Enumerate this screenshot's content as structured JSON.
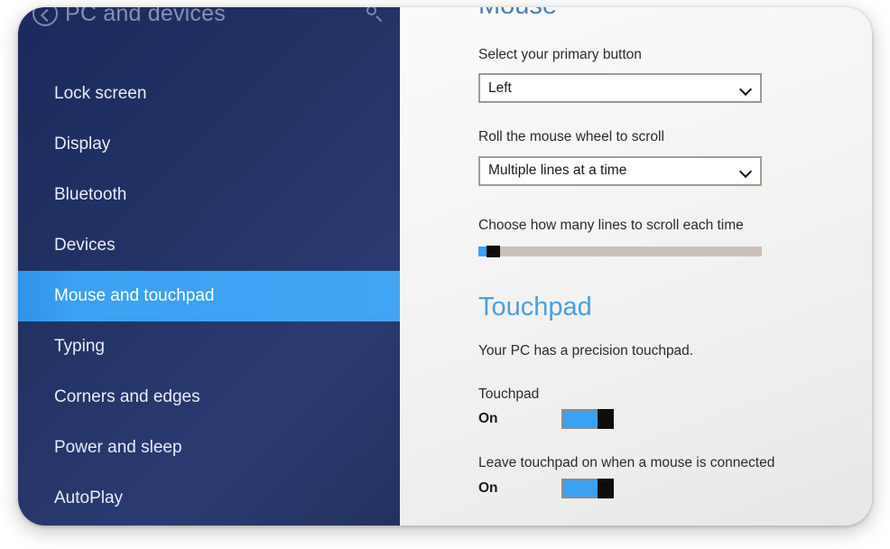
{
  "window": {
    "accent_blue": "#3ba1f2",
    "sidebar_navy": "#22315f",
    "heading_blue": "#49a0e2",
    "dropdown_border": "#a59a90"
  },
  "sidebar": {
    "header_title": "PC and devices",
    "back_icon": "back-arrow-icon",
    "search_icon": "search-icon",
    "items": [
      {
        "label": "Lock screen",
        "selected": false
      },
      {
        "label": "Display",
        "selected": false
      },
      {
        "label": "Bluetooth",
        "selected": false
      },
      {
        "label": "Devices",
        "selected": false
      },
      {
        "label": "Mouse and touchpad",
        "selected": true
      },
      {
        "label": "Typing",
        "selected": false
      },
      {
        "label": "Corners and edges",
        "selected": false
      },
      {
        "label": "Power and sleep",
        "selected": false
      },
      {
        "label": "AutoPlay",
        "selected": false
      }
    ]
  },
  "content": {
    "mouse": {
      "heading": "Mouse",
      "primary_button": {
        "label": "Select your primary button",
        "value": "Left",
        "chevron_icon": "chevron-down-icon"
      },
      "wheel_scroll": {
        "label": "Roll the mouse wheel to scroll",
        "value": "Multiple lines at a time",
        "chevron_icon": "chevron-down-icon"
      },
      "lines_slider": {
        "label": "Choose how many lines to scroll each time",
        "fill_percent": 3
      }
    },
    "touchpad": {
      "heading": "Touchpad",
      "description": "Your PC has a precision touchpad.",
      "toggles": [
        {
          "label": "Touchpad",
          "state": "On"
        },
        {
          "label": "Leave touchpad on when a mouse is connected",
          "state": "On"
        }
      ]
    }
  }
}
